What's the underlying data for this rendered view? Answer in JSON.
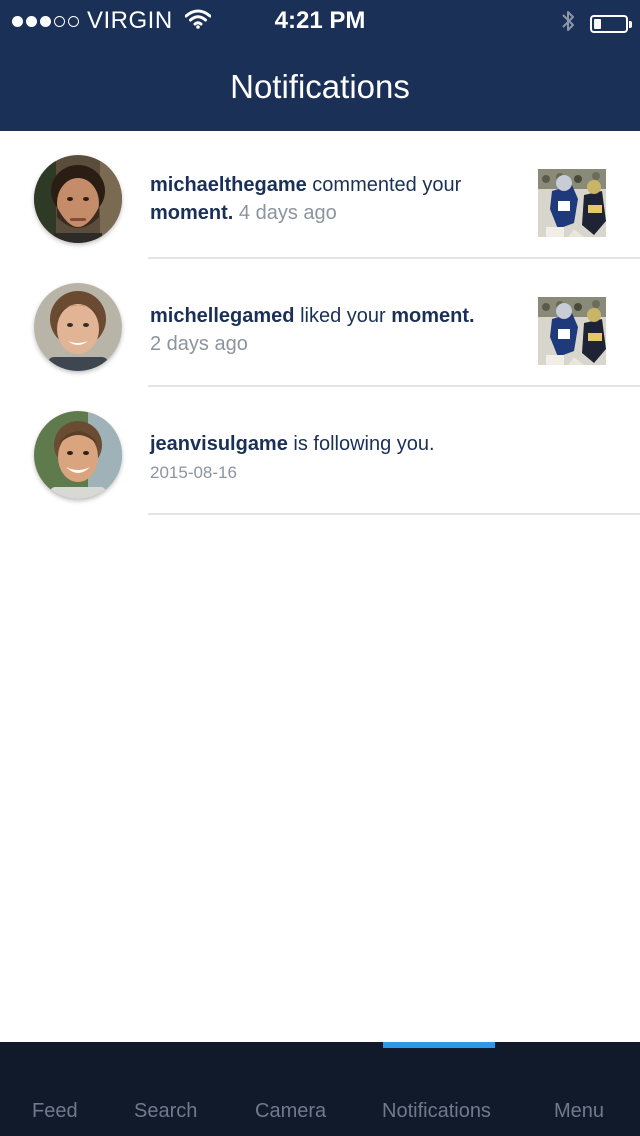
{
  "status_bar": {
    "carrier": "VIRGIN",
    "time": "4:21 PM",
    "signal_bars_filled": 3,
    "signal_bars_total": 5,
    "battery_level": 0.2,
    "icons": [
      "wifi-icon",
      "bluetooth-icon",
      "battery-icon"
    ]
  },
  "header": {
    "title": "Notifications"
  },
  "notifications": [
    {
      "user": "michaelthegame",
      "action": " commented your ",
      "object": "moment.",
      "time": " 4 days ago",
      "has_thumbnail": true
    },
    {
      "user": "michellegamed",
      "action": " liked your ",
      "object": "moment.",
      "time": "2 days ago",
      "has_thumbnail": true
    },
    {
      "user": "jeanvisulgame",
      "action": " is following you.",
      "object": "",
      "time": "2015-08-16",
      "has_thumbnail": false
    }
  ],
  "tabbar": {
    "tabs": [
      {
        "label": "Feed"
      },
      {
        "label": "Search"
      },
      {
        "label": "Camera"
      },
      {
        "label": "Notifications"
      },
      {
        "label": "Menu"
      }
    ],
    "active_tab": "Notifications"
  },
  "colors": {
    "header_bg": "#1b3057",
    "tabbar_bg": "#111a2b",
    "active_indicator": "#2d98e6",
    "username_text": "#1b3057",
    "time_text": "#8d949e",
    "tab_label": "#6f7a8c"
  }
}
